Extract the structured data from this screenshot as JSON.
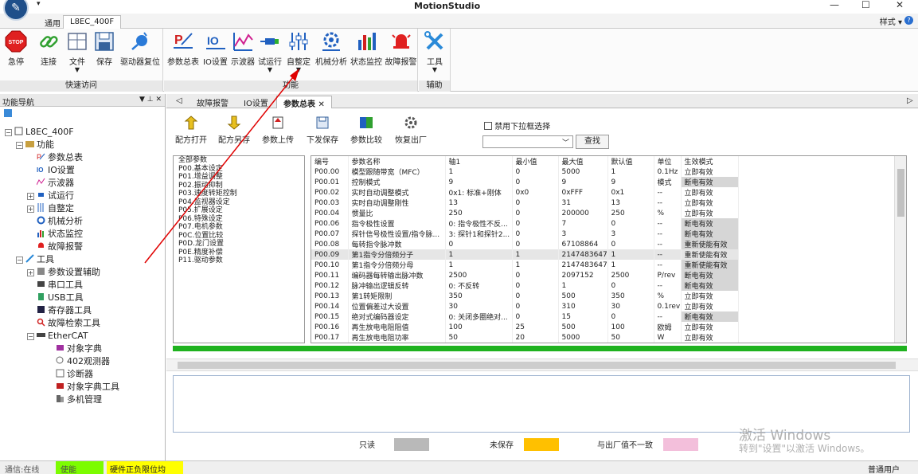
{
  "window": {
    "title": "MotionStudio"
  },
  "ribbon_tabs": {
    "general": "通用",
    "device": "L8EC_400F",
    "style": "样式"
  },
  "ribbon": {
    "groups": {
      "quick_access": "快速访问",
      "function": "功能",
      "assist": "辅助"
    },
    "buttons": {
      "estop": "急停",
      "connect": "连接",
      "file": "文件",
      "save": "保存",
      "reset": "驱动器复位",
      "param_table": "参数总表",
      "io": "IO设置",
      "scope": "示波器",
      "trial": "试运行",
      "autotune": "自整定",
      "mech": "机械分析",
      "monitor": "状态监控",
      "alarm": "故障报警",
      "tools": "工具"
    },
    "logo_text": "STOP"
  },
  "nav": {
    "title": "功能导航",
    "items": [
      "L8EC_400F",
      "功能",
      "参数总表",
      "IO设置",
      "示波器",
      "试运行",
      "自整定",
      "机械分析",
      "状态监控",
      "故障报警",
      "工具",
      "参数设置辅助",
      "串口工具",
      "USB工具",
      "寄存器工具",
      "故障检索工具",
      "EtherCAT",
      "对象字典",
      "402观测器",
      "诊断器",
      "对象字典工具",
      "多机管理"
    ]
  },
  "doc_tabs": {
    "t1": "故障报警",
    "t2": "IO设置",
    "t3": "参数总表"
  },
  "toolbar": {
    "open": "配方打开",
    "saveas": "配方另存",
    "upload": "参数上传",
    "download": "下发保存",
    "compare": "参数比较",
    "factory": "恢复出厂",
    "disable_dropdown": "禁用下拉框选择",
    "search": "查找"
  },
  "param_groups": [
    "全部参数",
    "P00.基本设定",
    "P01.增益调整",
    "P02.振动抑制",
    "P03.速度转矩控制",
    "P04.监视器设定",
    "P05.扩展设定",
    "P06.特殊设定",
    "P07.电机参数",
    "P0C.位置比较",
    "P0D.龙门设置",
    "P0E.精度补偿",
    "P11.驱动参数"
  ],
  "grid": {
    "headers": [
      "编号",
      "参数名称",
      "轴1",
      "最小值",
      "最大值",
      "默认值",
      "单位",
      "生效模式"
    ],
    "rows": [
      [
        "P00.00",
        "模型跟随带宽（MFC）",
        "1",
        "0",
        "5000",
        "1",
        "0.1Hz",
        "立即有效"
      ],
      [
        "P00.01",
        "控制模式",
        "9",
        "0",
        "9",
        "9",
        "模式",
        "断电有效"
      ],
      [
        "P00.02",
        "实时自动调整模式",
        "0x1: 标准+刚体",
        "0x0",
        "0xFFF",
        "0x1",
        "--",
        "立即有效"
      ],
      [
        "P00.03",
        "实时自动调整刚性",
        "13",
        "0",
        "31",
        "13",
        "--",
        "立即有效"
      ],
      [
        "P00.04",
        "惯量比",
        "250",
        "0",
        "200000",
        "250",
        "%",
        "立即有效"
      ],
      [
        "P00.06",
        "指令极性设置",
        "0: 指令极性不反...",
        "0",
        "7",
        "0",
        "--",
        "断电有效"
      ],
      [
        "P00.07",
        "探针信号极性设置/指令脉...",
        "3: 探针1和探针2...",
        "0",
        "3",
        "3",
        "--",
        "断电有效"
      ],
      [
        "P00.08",
        "每转指令脉冲数",
        "0",
        "0",
        "67108864",
        "0",
        "--",
        "重新使能有效"
      ],
      [
        "P00.09",
        "第1指令分倍频分子",
        "1",
        "1",
        "2147483647",
        "1",
        "--",
        "重新使能有效"
      ],
      [
        "P00.10",
        "第1指令分倍频分母",
        "1",
        "1",
        "2147483647",
        "1",
        "--",
        "重新使能有效"
      ],
      [
        "P00.11",
        "编码器每转输出脉冲数",
        "2500",
        "0",
        "2097152",
        "2500",
        "P/rev",
        "断电有效"
      ],
      [
        "P00.12",
        "脉冲输出逻辑反转",
        "0: 不反转",
        "0",
        "1",
        "0",
        "--",
        "断电有效"
      ],
      [
        "P00.13",
        "第1转矩限制",
        "350",
        "0",
        "500",
        "350",
        "%",
        "立即有效"
      ],
      [
        "P00.14",
        "位置偏差过大设置",
        "30",
        "0",
        "310",
        "30",
        "0.1rev",
        "立即有效"
      ],
      [
        "P00.15",
        "绝对式编码器设定",
        "0: 关闭多圈绝对...",
        "0",
        "15",
        "0",
        "--",
        "断电有效"
      ],
      [
        "P00.16",
        "再生放电电阻阻值",
        "100",
        "25",
        "500",
        "100",
        "欧姆",
        "立即有效"
      ],
      [
        "P00.17",
        "再生放电电阻功率",
        "50",
        "20",
        "5000",
        "50",
        "W",
        "立即有效"
      ]
    ],
    "gray_rows": [
      1,
      5,
      6,
      7,
      8,
      9,
      10,
      11,
      14
    ]
  },
  "legend": {
    "readonly": "只读",
    "unsaved": "未保存",
    "diff": "与出厂值不一致"
  },
  "colors": {
    "readonly": "#b9b9b9",
    "unsaved": "#ffc000",
    "diff": "#f3bfdb",
    "progress": "#1fb21f",
    "enabled": "#7cfc00",
    "warning": "#ffff00"
  },
  "status": {
    "comm": "通信:在线",
    "enable": "使能",
    "warning": "硬件正负限位均有...",
    "user": "普通用户"
  },
  "watermark": {
    "line1": "激活 Windows",
    "line2": "转到\"设置\"以激活 Windows。"
  }
}
